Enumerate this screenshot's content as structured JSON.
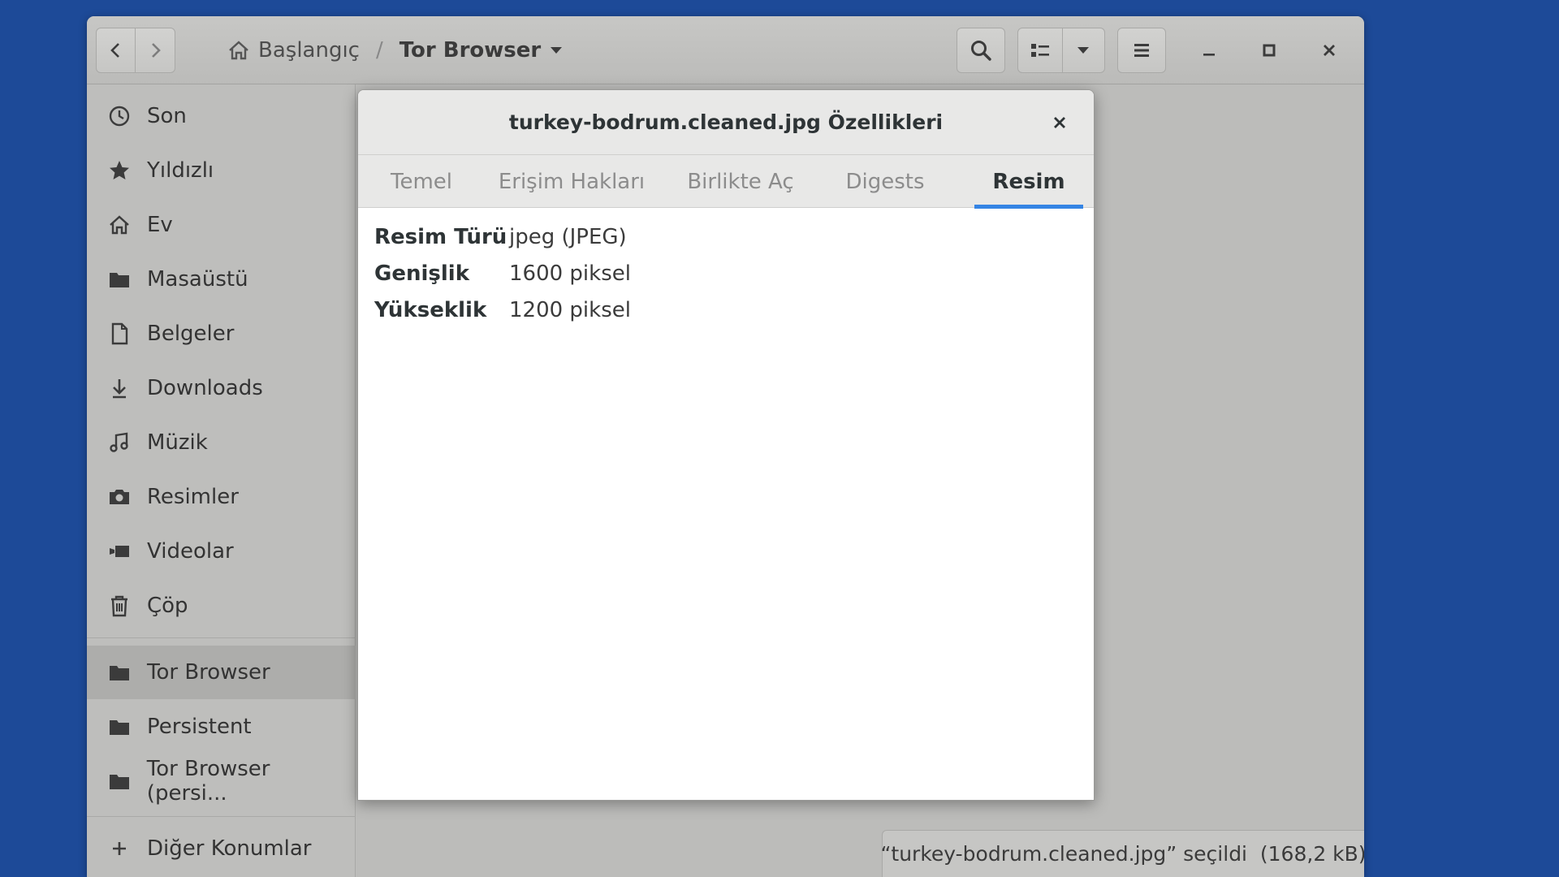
{
  "header": {
    "breadcrumb": [
      {
        "label": "Başlangıç",
        "icon": "home-icon"
      },
      {
        "label": "Tor Browser",
        "icon": "chevron-down-icon"
      }
    ],
    "separator": "/"
  },
  "sidebar": {
    "items": [
      {
        "label": "Son",
        "icon": "clock-icon"
      },
      {
        "label": "Yıldızlı",
        "icon": "star-icon"
      },
      {
        "label": "Ev",
        "icon": "home-icon"
      },
      {
        "label": "Masaüstü",
        "icon": "folder-icon"
      },
      {
        "label": "Belgeler",
        "icon": "document-icon"
      },
      {
        "label": "Downloads",
        "icon": "download-icon"
      },
      {
        "label": "Müzik",
        "icon": "music-icon"
      },
      {
        "label": "Resimler",
        "icon": "camera-icon"
      },
      {
        "label": "Videolar",
        "icon": "video-icon"
      },
      {
        "label": "Çöp",
        "icon": "trash-icon"
      }
    ],
    "bookmarks": [
      {
        "label": "Tor Browser",
        "icon": "folder-icon",
        "active": true
      },
      {
        "label": "Persistent",
        "icon": "folder-icon"
      },
      {
        "label": "Tor Browser (persi...",
        "icon": "folder-icon"
      }
    ],
    "other": {
      "label": "Diğer Konumlar",
      "icon": "plus-icon"
    }
  },
  "dialog": {
    "title": "turkey-bodrum.cleaned.jpg Özellikleri",
    "tabs": [
      "Temel",
      "Erişim Hakları",
      "Birlikte Aç",
      "Digests",
      "Resim"
    ],
    "active_tab": "Resim",
    "properties": [
      {
        "key": "Resim Türü",
        "value": "jpeg (JPEG)"
      },
      {
        "key": "Genişlik",
        "value": "1600 piksel"
      },
      {
        "key": "Yükseklik",
        "value": "1200 piksel"
      }
    ]
  },
  "status": {
    "text": "“turkey-bodrum.cleaned.jpg” seçildi  (168,2 kB)"
  },
  "colors": {
    "desktop": "#1d4a98",
    "accent": "#3584e4"
  }
}
